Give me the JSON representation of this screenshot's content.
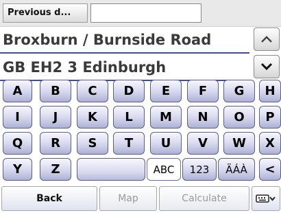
{
  "top": {
    "previous_label": "Previous d...",
    "previous_input_value": ""
  },
  "address": {
    "line1": "Broxburn / Burnside Road",
    "line2": "GB EH2 3 Edinburgh"
  },
  "scroll": {
    "up_icon": "chevron-up-icon",
    "down_icon": "chevron-down-icon"
  },
  "keyboard": {
    "row1": [
      "A",
      "B",
      "C",
      "D",
      "E",
      "F",
      "G",
      "H"
    ],
    "row2": [
      "I",
      "J",
      "K",
      "L",
      "M",
      "N",
      "O",
      "P"
    ],
    "row3": [
      "Q",
      "R",
      "S",
      "T",
      "U",
      "V",
      "W",
      "X"
    ],
    "row4": {
      "y": "Y",
      "z": "Z",
      "space": "",
      "abc": "ABC",
      "num": "123",
      "accents": "ÄÁÀ",
      "backspace": "<"
    }
  },
  "buttons": {
    "back": "Back",
    "map": "Map",
    "calculate": "Calculate",
    "keyboard_icon": "keyboard-icon"
  }
}
